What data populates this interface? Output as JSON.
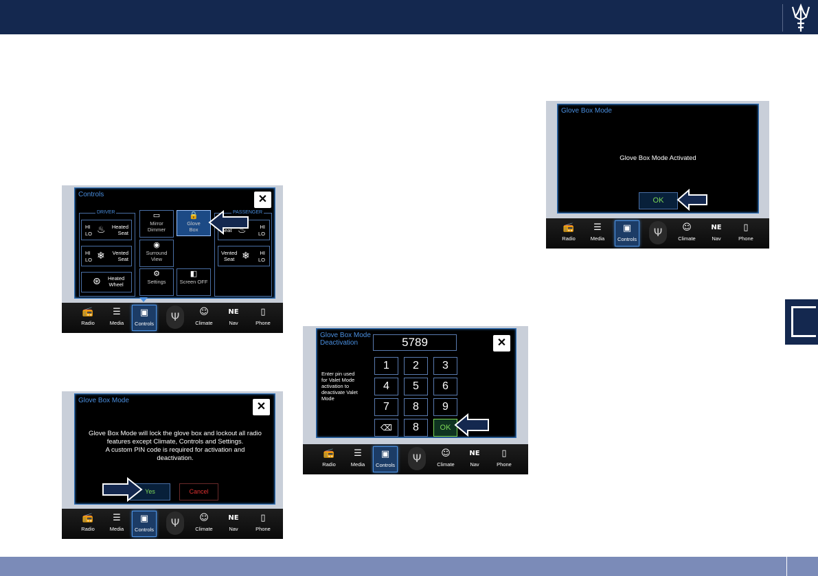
{
  "nav_labels": [
    "Radio",
    "Media",
    "Controls",
    "Climate",
    "Nav",
    "Phone"
  ],
  "nav_icons": [
    "📻",
    "☰",
    "▣",
    "☺",
    "NE",
    "▯"
  ],
  "controls_screen": {
    "title": "Controls",
    "close": "✕",
    "driver_label": "DRIVER",
    "passenger_label": "PASSENGER",
    "heated_seat_driver": {
      "hi": "HI",
      "lo": "LO",
      "label": "Heated\nSeat"
    },
    "vented_seat_driver": {
      "hi": "HI",
      "lo": "LO",
      "label": "Vented\nSeat"
    },
    "heated_wheel": "Heated\nWheel",
    "mirror_dimmer": "Mirror\nDimmer",
    "surround_view": "Surround\nView",
    "settings": "Settings",
    "glove_box": "Glove\nBox",
    "screen_off": "Screen OFF",
    "heated_seat_passenger": {
      "hi": "HI",
      "lo": "LO",
      "label": "Seat"
    },
    "vented_seat_passenger": {
      "hi": "HI",
      "lo": "LO",
      "label": "Vented\nSeat"
    }
  },
  "glove_box_mode_screen": {
    "title": "Glove Box Mode",
    "close": "✕",
    "message": "Glove Box Mode will lock the glove box and lockout all radio features except Climate, Controls and Settings.\nA custom PIN code is required for activation and deactivation.",
    "yes": "Yes",
    "cancel": "Cancel"
  },
  "deactivation_screen": {
    "title": "Glove Box Mode\nDeactivation",
    "pin": "5789",
    "close": "✕",
    "instruction": "Enter pin used\nfor Valet Mode\nactivation to\ndeactivate Valet\nMode",
    "keys": [
      "1",
      "2",
      "3",
      "4",
      "5",
      "6",
      "7",
      "8",
      "9"
    ],
    "backspace": "⌫",
    "zero_key": "8",
    "ok": "OK"
  },
  "activated_screen": {
    "title": "Glove Box Mode",
    "message": "Glove Box Mode Activated",
    "ok": "OK"
  },
  "colors": {
    "header": "#14284f",
    "footer": "#7b8bb8",
    "accent": "#4a8fe0",
    "ok_green": "#7ed957",
    "cancel_red": "#e03030"
  }
}
